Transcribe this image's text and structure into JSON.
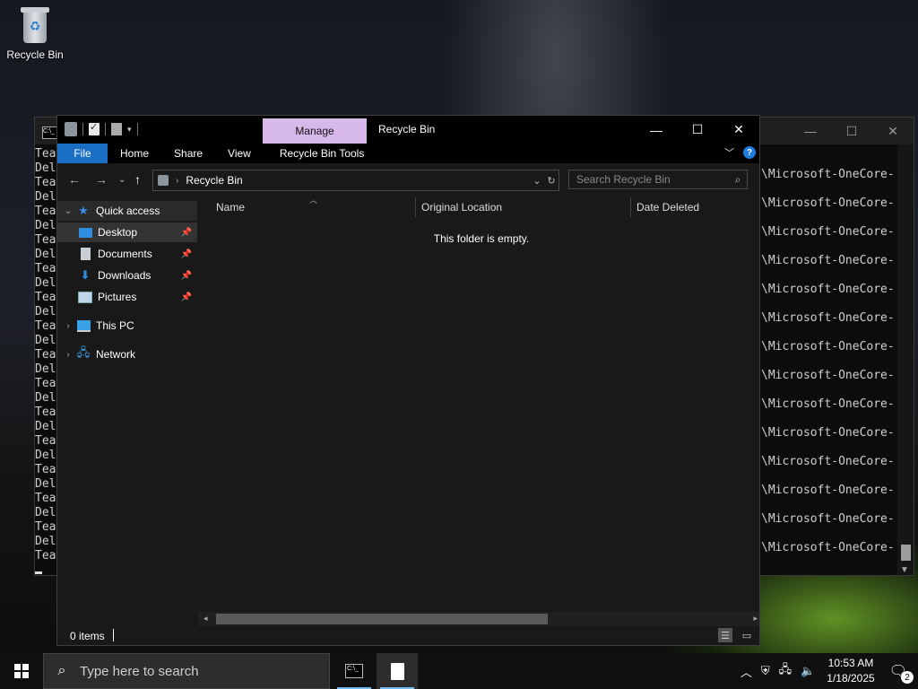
{
  "desktop": {
    "recycle_bin_label": "Recycle Bin"
  },
  "console": {
    "left_lines": [
      "Tea",
      "Del",
      "Tea",
      "Del",
      "Tea",
      "Del",
      "Tea",
      "Del",
      "Tea",
      "Del",
      "Tea",
      "Del",
      "Tea",
      "Del",
      "Tea",
      "Del",
      "Tea",
      "Del",
      "Tea",
      "Del",
      "Tea",
      "Del",
      "Tea",
      "Del",
      "Tea",
      "Del",
      "Tea",
      "Del",
      "Tea"
    ],
    "right_lines": [
      "\\Microsoft-OneCore-",
      "\\Microsoft-OneCore-",
      "\\Microsoft-OneCore-",
      "\\Microsoft-OneCore-",
      "\\Microsoft-OneCore-",
      "\\Microsoft-OneCore-",
      "\\Microsoft-OneCore-",
      "\\Microsoft-OneCore-",
      "\\Microsoft-OneCore-",
      "\\Microsoft-OneCore-",
      "\\Microsoft-OneCore-",
      "\\Microsoft-OneCore-",
      "\\Microsoft-OneCore-",
      "\\Microsoft-OneCore-"
    ],
    "minimize": "—",
    "maximize": "☐",
    "close": "✕"
  },
  "explorer": {
    "title": "Recycle Bin",
    "manage_tab": "Manage",
    "window_buttons": {
      "minimize": "—",
      "maximize": "☐",
      "close": "✕"
    },
    "ribbon": {
      "file": "File",
      "home": "Home",
      "share": "Share",
      "view": "View",
      "tools": "Recycle Bin Tools",
      "help": "?"
    },
    "address": {
      "path": "Recycle Bin",
      "search_placeholder": "Search Recycle Bin"
    },
    "nav": {
      "quick_access": "Quick access",
      "desktop": "Desktop",
      "documents": "Documents",
      "downloads": "Downloads",
      "pictures": "Pictures",
      "this_pc": "This PC",
      "network": "Network"
    },
    "columns": {
      "name": "Name",
      "original_location": "Original Location",
      "date_deleted": "Date Deleted"
    },
    "empty_message": "This folder is empty.",
    "status": {
      "item_count": "0 items"
    }
  },
  "taskbar": {
    "search_placeholder": "Type here to search",
    "time": "10:53 AM",
    "date": "1/18/2025",
    "notification_count": "2"
  },
  "colors": {
    "accent_blue": "#1a6fc4",
    "manage_tab": "#d7b8ea",
    "explorer_bg": "#191919"
  }
}
